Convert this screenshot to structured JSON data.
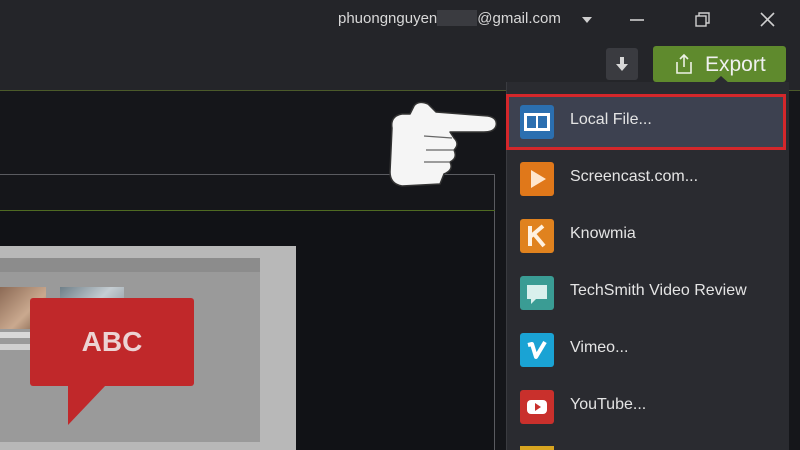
{
  "titlebar": {
    "account_prefix": "phuongnguyen",
    "account_suffix": "@gmail.com"
  },
  "toolbar": {
    "export_label": "Export"
  },
  "canvas": {
    "bubble_text": "ABC"
  },
  "export_menu": {
    "items": [
      {
        "label": "Local File...",
        "icon": "film-icon",
        "color": "#2b6fb0",
        "selected": true
      },
      {
        "label": "Screencast.com...",
        "icon": "screencast-icon",
        "color": "#e0781a"
      },
      {
        "label": "Knowmia",
        "icon": "knowmia-icon",
        "color": "#e0821e"
      },
      {
        "label": "TechSmith Video Review",
        "icon": "video-review-icon",
        "color": "#3a9c94"
      },
      {
        "label": "Vimeo...",
        "icon": "vimeo-icon",
        "color": "#1aa3d4"
      },
      {
        "label": "YouTube...",
        "icon": "youtube-icon",
        "color": "#c9302c"
      }
    ]
  },
  "colors": {
    "accent_green": "#5f8a2d",
    "highlight_red": "#d4272b"
  }
}
